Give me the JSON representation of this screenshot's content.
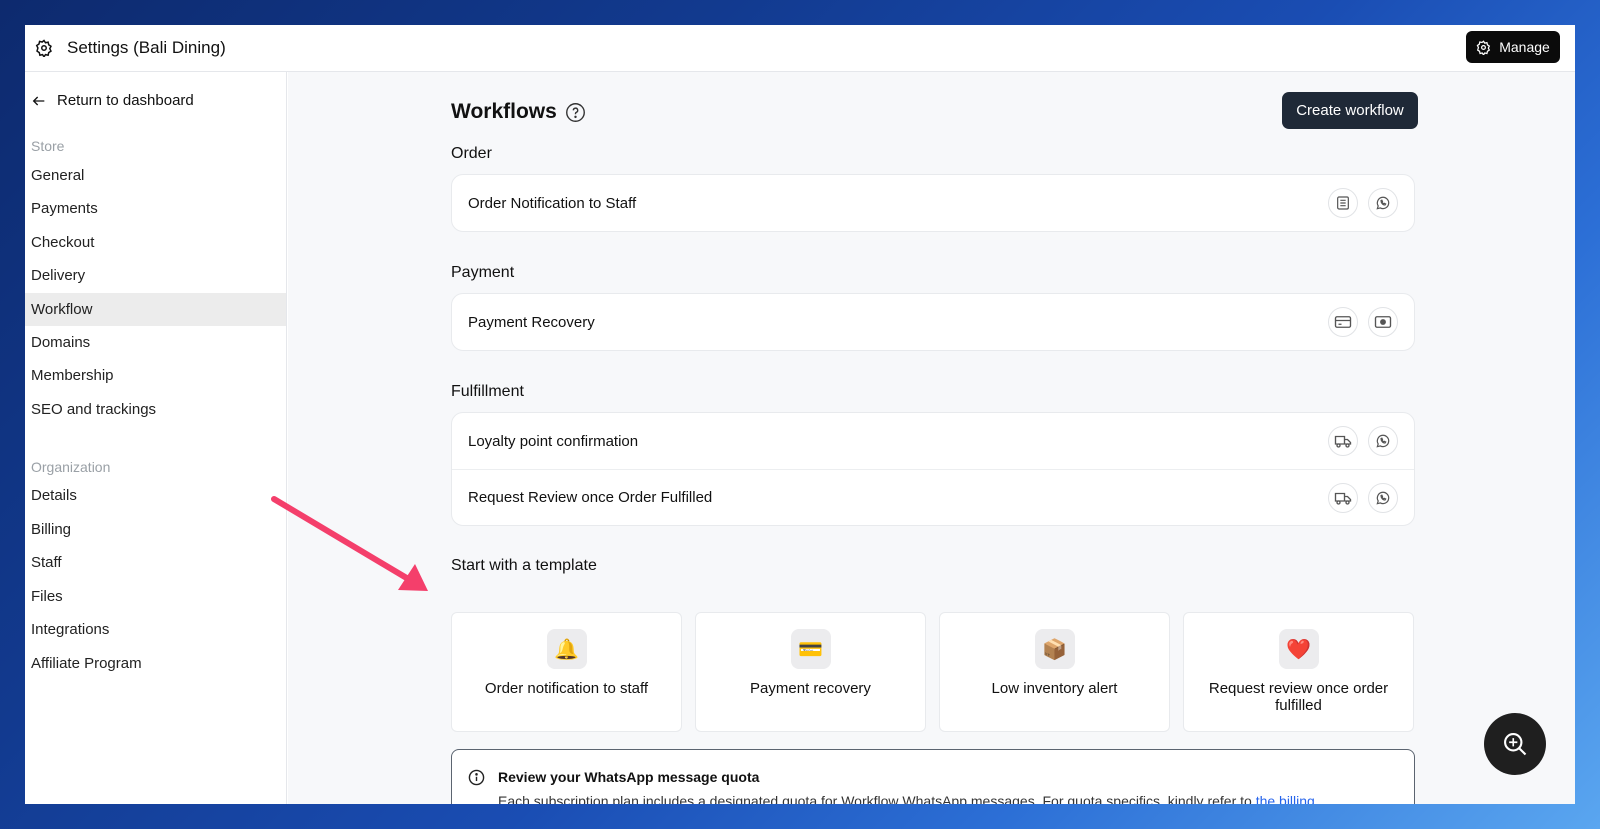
{
  "header": {
    "title": "Settings (Bali Dining)",
    "manage_label": "Manage"
  },
  "sidebar": {
    "back_label": "Return to dashboard",
    "store_section": "Store",
    "store_items": [
      "General",
      "Payments",
      "Checkout",
      "Delivery",
      "Workflow",
      "Domains",
      "Membership",
      "SEO and trackings"
    ],
    "active_item": "Workflow",
    "org_section": "Organization",
    "org_items": [
      "Details",
      "Billing",
      "Staff",
      "Files",
      "Integrations",
      "Affiliate Program"
    ]
  },
  "main": {
    "title": "Workflows",
    "create_label": "Create workflow",
    "groups": [
      {
        "label": "Order",
        "rows": [
          {
            "label": "Order Notification to Staff",
            "icons": [
              "list-icon",
              "whatsapp-icon"
            ]
          }
        ]
      },
      {
        "label": "Payment",
        "rows": [
          {
            "label": "Payment Recovery",
            "icons": [
              "credit-card-icon",
              "cash-icon"
            ]
          }
        ]
      },
      {
        "label": "Fulfillment",
        "rows": [
          {
            "label": "Loyalty point confirmation",
            "icons": [
              "truck-icon",
              "whatsapp-icon"
            ]
          },
          {
            "label": "Request Review once Order Fulfilled",
            "icons": [
              "truck-icon",
              "whatsapp-icon"
            ]
          }
        ]
      }
    ],
    "templates_label": "Start with a template",
    "templates": [
      {
        "label": "Order notification to staff",
        "emoji": "🔔"
      },
      {
        "label": "Payment recovery",
        "emoji": "💳"
      },
      {
        "label": "Low inventory alert",
        "emoji": "📦"
      },
      {
        "label": "Request review once order fulfilled",
        "emoji": "❤️"
      }
    ],
    "notice": {
      "title": "Review your WhatsApp message quota",
      "text": "Each subscription plan includes a designated quota for Workflow WhatsApp messages. For quota specifics, kindly refer to ",
      "link": "the billing"
    }
  },
  "colors": {
    "accent_link": "#2563eb",
    "active_nav_bg": "#ececec",
    "annotation_arrow": "#f43f6b"
  }
}
